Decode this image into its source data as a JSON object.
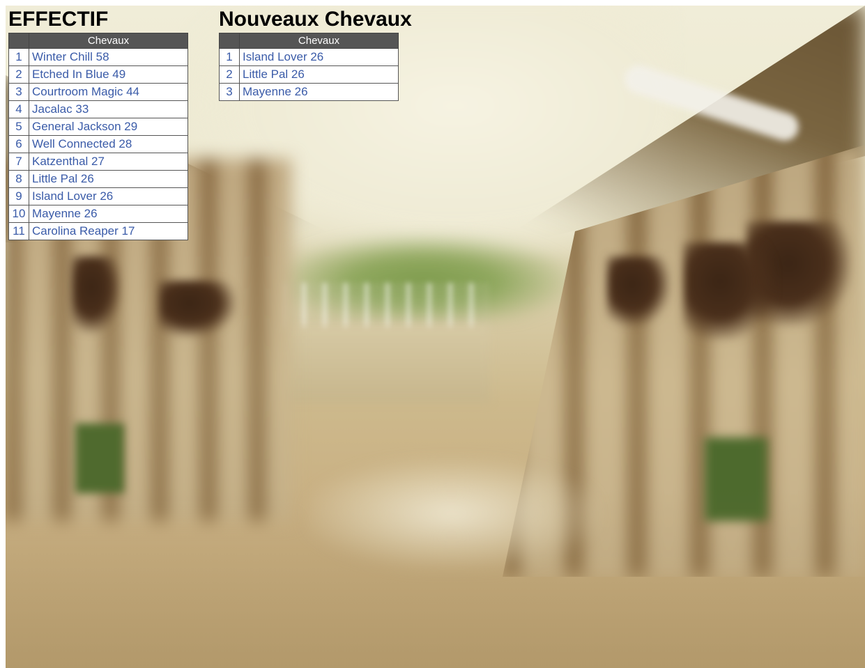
{
  "effectif": {
    "title": "EFFECTIF",
    "column_header": "Chevaux",
    "rows": [
      {
        "rank": "1",
        "label": "Winter Chill 58"
      },
      {
        "rank": "2",
        "label": "Etched In Blue 49"
      },
      {
        "rank": "3",
        "label": "Courtroom Magic 44"
      },
      {
        "rank": "4",
        "label": "Jacalac 33"
      },
      {
        "rank": "5",
        "label": "General Jackson 29"
      },
      {
        "rank": "6",
        "label": "Well Connected 28"
      },
      {
        "rank": "7",
        "label": "Katzenthal 27"
      },
      {
        "rank": "8",
        "label": "Little Pal 26"
      },
      {
        "rank": "9",
        "label": "Island Lover 26"
      },
      {
        "rank": "10",
        "label": "Mayenne 26"
      },
      {
        "rank": "11",
        "label": "Carolina Reaper 17"
      }
    ]
  },
  "nouveaux": {
    "title": "Nouveaux Chevaux",
    "column_header": "Chevaux",
    "rows": [
      {
        "rank": "1",
        "label": "Island Lover 26"
      },
      {
        "rank": "2",
        "label": "Little Pal 26"
      },
      {
        "rank": "3",
        "label": "Mayenne 26"
      }
    ]
  },
  "colors": {
    "link": "#3a5ba8",
    "header_bg": "#555555",
    "header_text": "#ffffff"
  }
}
